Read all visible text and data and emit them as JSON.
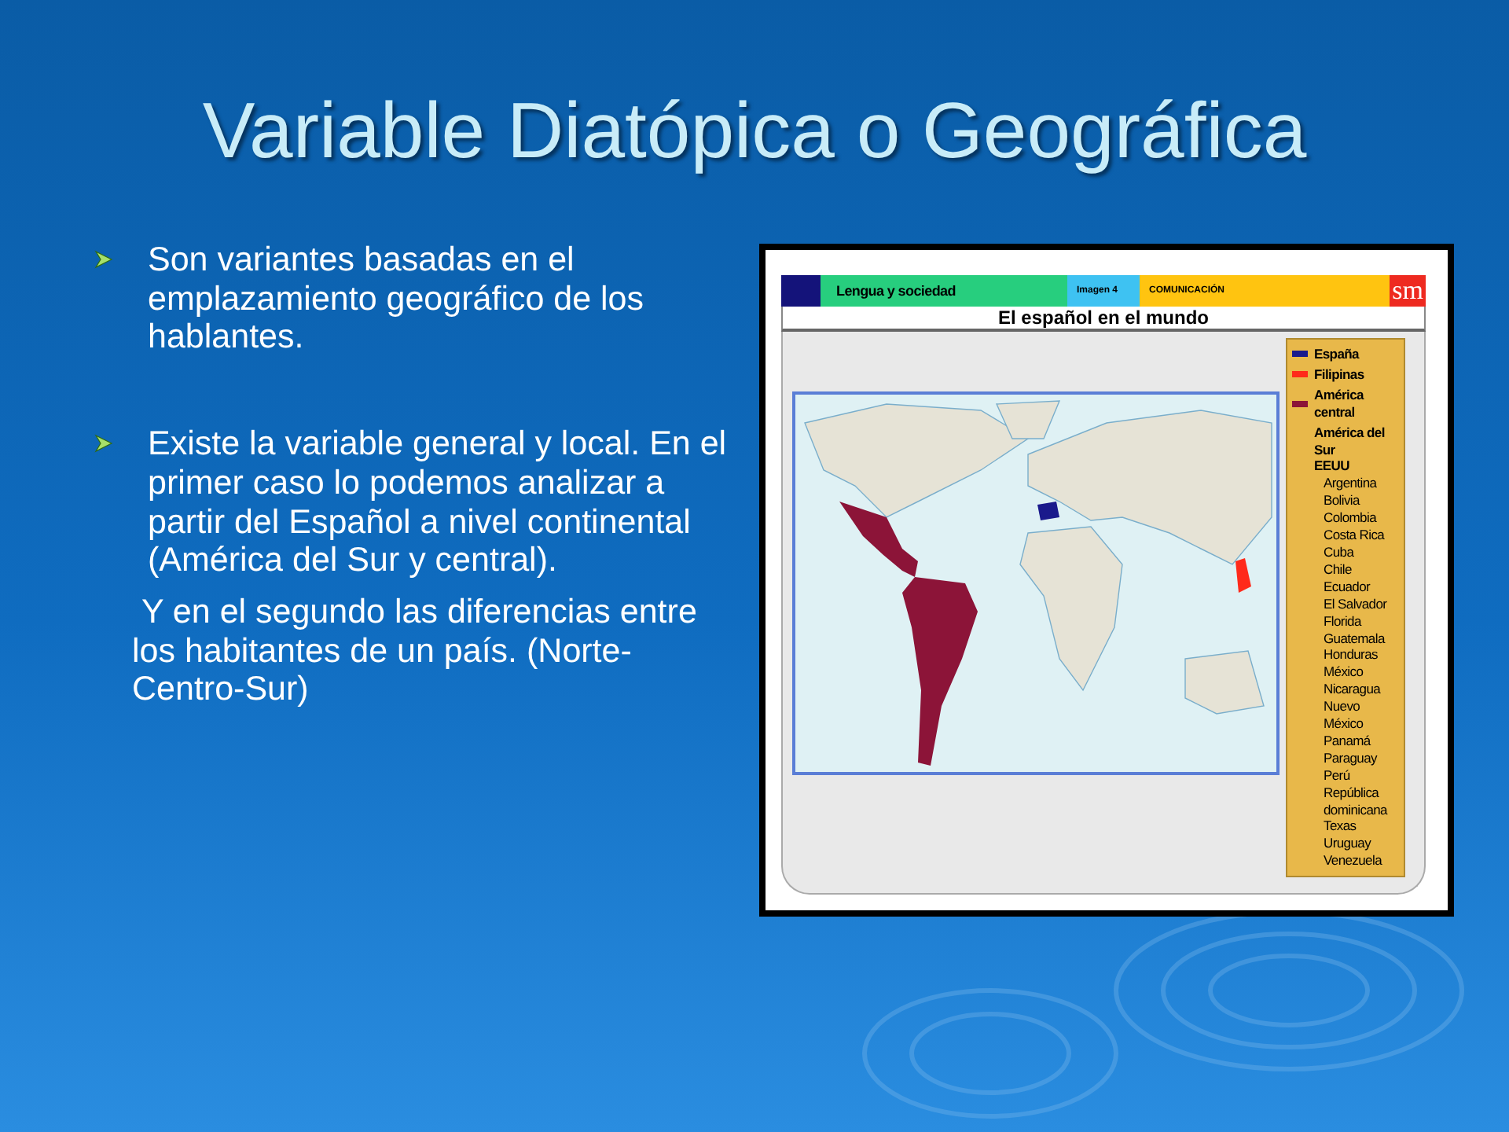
{
  "title": "Variable Diatópica o Geográfica",
  "bullets": [
    {
      "kind": "bullet",
      "text": "Son variantes basadas en el emplazamiento geográfico de los hablantes."
    },
    {
      "kind": "bullet",
      "text": "Existe la variable general y local. En el primer caso lo podemos analizar a partir del Español a nivel continental (América del Sur y central)."
    },
    {
      "kind": "continuation",
      "text": "Y en el segundo las diferencias entre los habitantes de un país. (Norte-Centro-Sur)"
    }
  ],
  "figure": {
    "header": {
      "section": "Lengua y sociedad",
      "image_label": "Imagen 4",
      "category": "COMUNICACIÓN",
      "logo": "sm"
    },
    "map_title": "El español en el mundo",
    "legend": [
      {
        "kind": "swatch",
        "label": "España",
        "color": "#1a1a8c"
      },
      {
        "kind": "swatch",
        "label": "Filipinas",
        "color": "#ff2a1a"
      },
      {
        "kind": "swatch",
        "label": "América central",
        "color": "#8c1438"
      },
      {
        "kind": "heading",
        "label": "América del Sur"
      },
      {
        "kind": "heading",
        "label": "EEUU"
      },
      {
        "kind": "country",
        "label": "Argentina"
      },
      {
        "kind": "country",
        "label": "Bolivia"
      },
      {
        "kind": "country",
        "label": "Colombia"
      },
      {
        "kind": "country",
        "label": "Costa Rica"
      },
      {
        "kind": "country",
        "label": "Cuba"
      },
      {
        "kind": "country",
        "label": "Chile"
      },
      {
        "kind": "country",
        "label": "Ecuador"
      },
      {
        "kind": "country",
        "label": "El Salvador"
      },
      {
        "kind": "country",
        "label": "Florida"
      },
      {
        "kind": "country",
        "label": "Guatemala"
      },
      {
        "kind": "country",
        "label": "Honduras"
      },
      {
        "kind": "country",
        "label": "México"
      },
      {
        "kind": "country",
        "label": "Nicaragua"
      },
      {
        "kind": "country",
        "label": "Nuevo México"
      },
      {
        "kind": "country",
        "label": "Panamá"
      },
      {
        "kind": "country",
        "label": "Paraguay"
      },
      {
        "kind": "country",
        "label": "Perú"
      },
      {
        "kind": "country",
        "label": "República dominicana"
      },
      {
        "kind": "country",
        "label": "Texas"
      },
      {
        "kind": "country",
        "label": "Uruguay"
      },
      {
        "kind": "country",
        "label": "Venezuela"
      }
    ]
  }
}
